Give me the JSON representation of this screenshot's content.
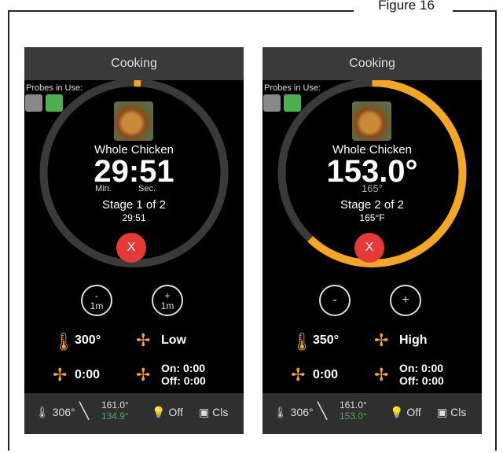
{
  "figure_title": "Figure 16",
  "screens": [
    {
      "header": "Cooking",
      "probes_label": "Probes in Use:",
      "food_name": "Whole Chicken",
      "big_value": "29:51",
      "unit_min": "Min.",
      "unit_sec": "Sec.",
      "stage": "Stage 1 of 2",
      "stage_sub": "29:51",
      "cancel_label": "X",
      "ring_progress": 0.01,
      "minus": {
        "sign": "-",
        "sub": "1m"
      },
      "plus": {
        "sign": "+",
        "sub": "1m"
      },
      "temp": "300°",
      "fan": "Low",
      "timer": "0:00",
      "on": "On: 0:00",
      "off": "Off: 0:00",
      "footer": {
        "oven_temp": "306°",
        "probe_top": "161.0°",
        "probe_bottom": "134.9°",
        "light": "Off",
        "door": "Cls"
      }
    },
    {
      "header": "Cooking",
      "probes_label": "Probes in Use:",
      "food_name": "Whole Chicken",
      "big_value": "153.0°",
      "sub_temp": "165°",
      "stage": "Stage 2 of 2",
      "stage_sub": "165°F",
      "cancel_label": "X",
      "ring_progress": 0.62,
      "minus": {
        "sign": "-"
      },
      "plus": {
        "sign": "+"
      },
      "temp": "350°",
      "fan": "High",
      "timer": "0:00",
      "on": "On: 0:00",
      "off": "Off: 0:00",
      "footer": {
        "oven_temp": "306°",
        "probe_top": "161.0°",
        "probe_bottom": "153.0°",
        "light": "Off",
        "door": "Cls"
      }
    }
  ],
  "colors": {
    "accent": "#f5a623",
    "cancel": "#e53935",
    "probe_green": "#4caf50",
    "header_bg": "#3a3a3a",
    "footer_bg": "#2f2f2f"
  }
}
